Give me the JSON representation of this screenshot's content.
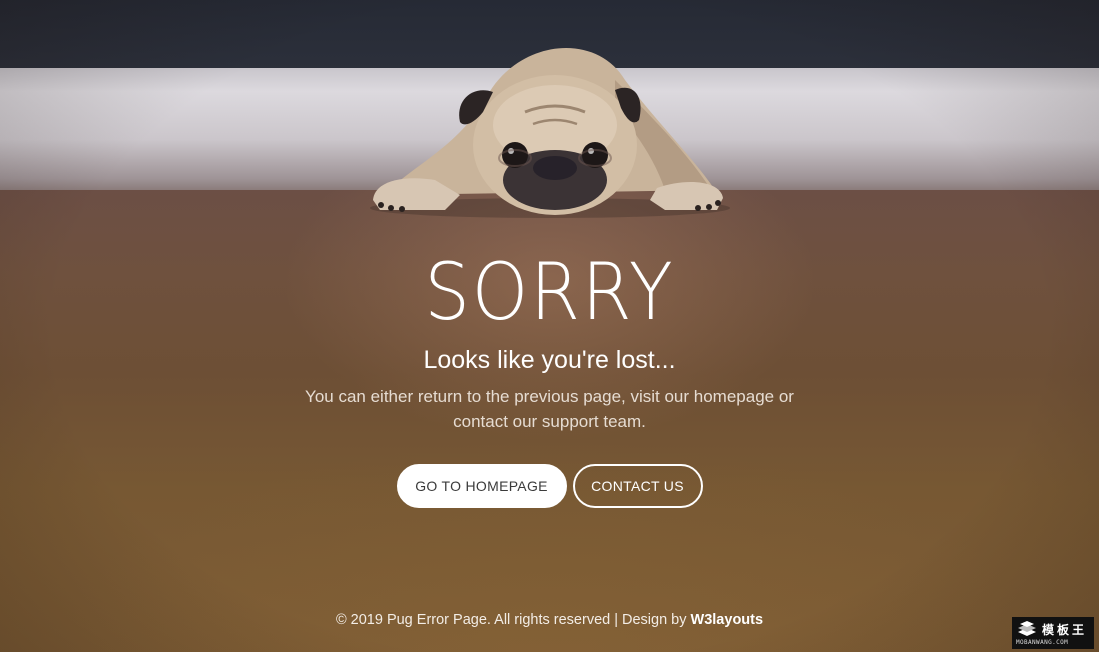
{
  "hero": {
    "title": "SORRY",
    "subtitle": "Looks like you're lost...",
    "description": "You can either return to the previous page, visit our homepage or contact our support team."
  },
  "buttons": {
    "home_label": "GO TO HOMEPAGE",
    "contact_label": "CONTACT US"
  },
  "footer": {
    "copyright": "© 2019 Pug Error Page. All rights reserved | Design by",
    "brand": "W3layouts"
  },
  "watermark": {
    "site_name": "模板王",
    "url": "MOBANWANG.COM",
    "logo_icon": "stacked-book-icon"
  },
  "colors": {
    "text": "#ffffff",
    "description": "#e6dcd2",
    "button_fill": "#ffffff",
    "button_text_dark": "#3b3b3b",
    "floor": "#775833",
    "wall": "#262a35"
  }
}
